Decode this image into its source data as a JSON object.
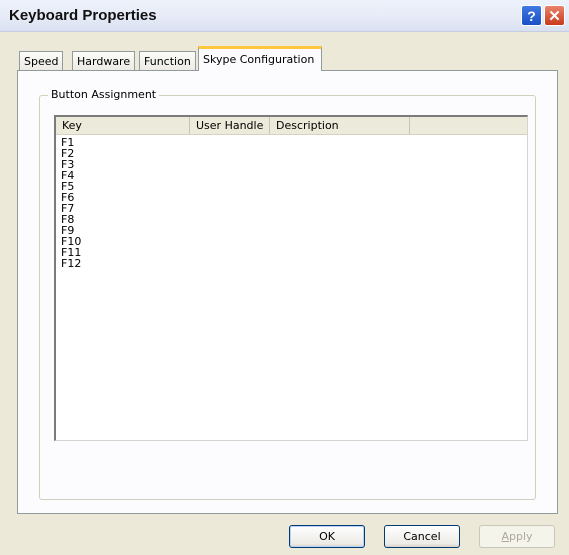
{
  "window": {
    "title": "Keyboard Properties"
  },
  "titlebar": {
    "help_glyph": "?",
    "close_glyph": "✕"
  },
  "tabs": [
    {
      "label": "Speed",
      "active": false
    },
    {
      "label": "Hardware",
      "active": false
    },
    {
      "label": "Function",
      "active": false
    },
    {
      "label": "Skype Configuration",
      "active": true
    }
  ],
  "group": {
    "label": "Button Assignment"
  },
  "listview": {
    "columns": [
      "Key",
      "User Handle",
      "Description",
      ""
    ],
    "rows": [
      "F1",
      "F2",
      "F3",
      "F4",
      "F5",
      "F6",
      "F7",
      "F8",
      "F9",
      "F10",
      "F11",
      "F12"
    ]
  },
  "buttons": {
    "ok": "OK",
    "cancel": "Cancel",
    "apply_first": "A",
    "apply_rest": "pply",
    "apply_enabled": false
  },
  "colors": {
    "active_tab_accent": "#ffc83c",
    "dialog_bg": "#ece9d8"
  }
}
